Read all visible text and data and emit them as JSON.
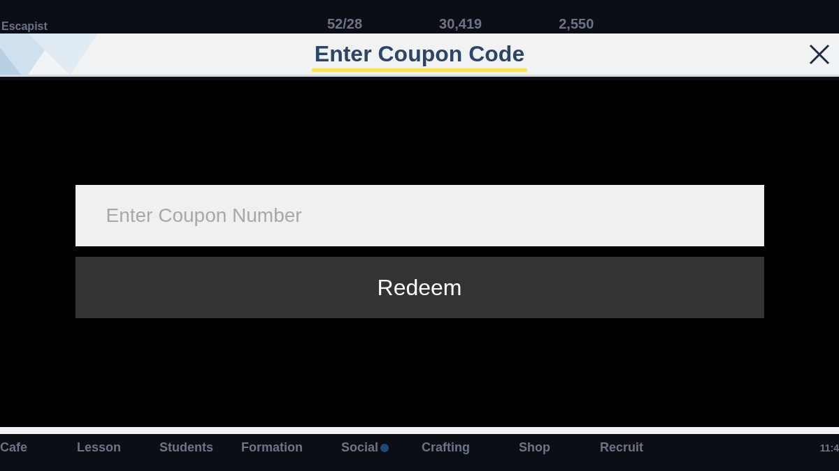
{
  "background_top": {
    "player_name": "Escapist",
    "resources": [
      {
        "value": "52/28"
      },
      {
        "value": "30,419"
      },
      {
        "value": "2,550"
      }
    ]
  },
  "dialog": {
    "title": "Enter Coupon Code",
    "coupon_field": {
      "placeholder": "Enter Coupon Number"
    },
    "redeem_button": "Redeem"
  },
  "background_nav": {
    "items": [
      {
        "label": "Cafe",
        "badge": false
      },
      {
        "label": "Lesson",
        "badge": false
      },
      {
        "label": "Students",
        "badge": false
      },
      {
        "label": "Formation",
        "badge": false
      },
      {
        "label": "Social",
        "badge": true
      },
      {
        "label": "Crafting",
        "badge": false
      },
      {
        "label": "Shop",
        "badge": false
      },
      {
        "label": "Recruit",
        "badge": false
      }
    ],
    "clock": "11:4"
  }
}
